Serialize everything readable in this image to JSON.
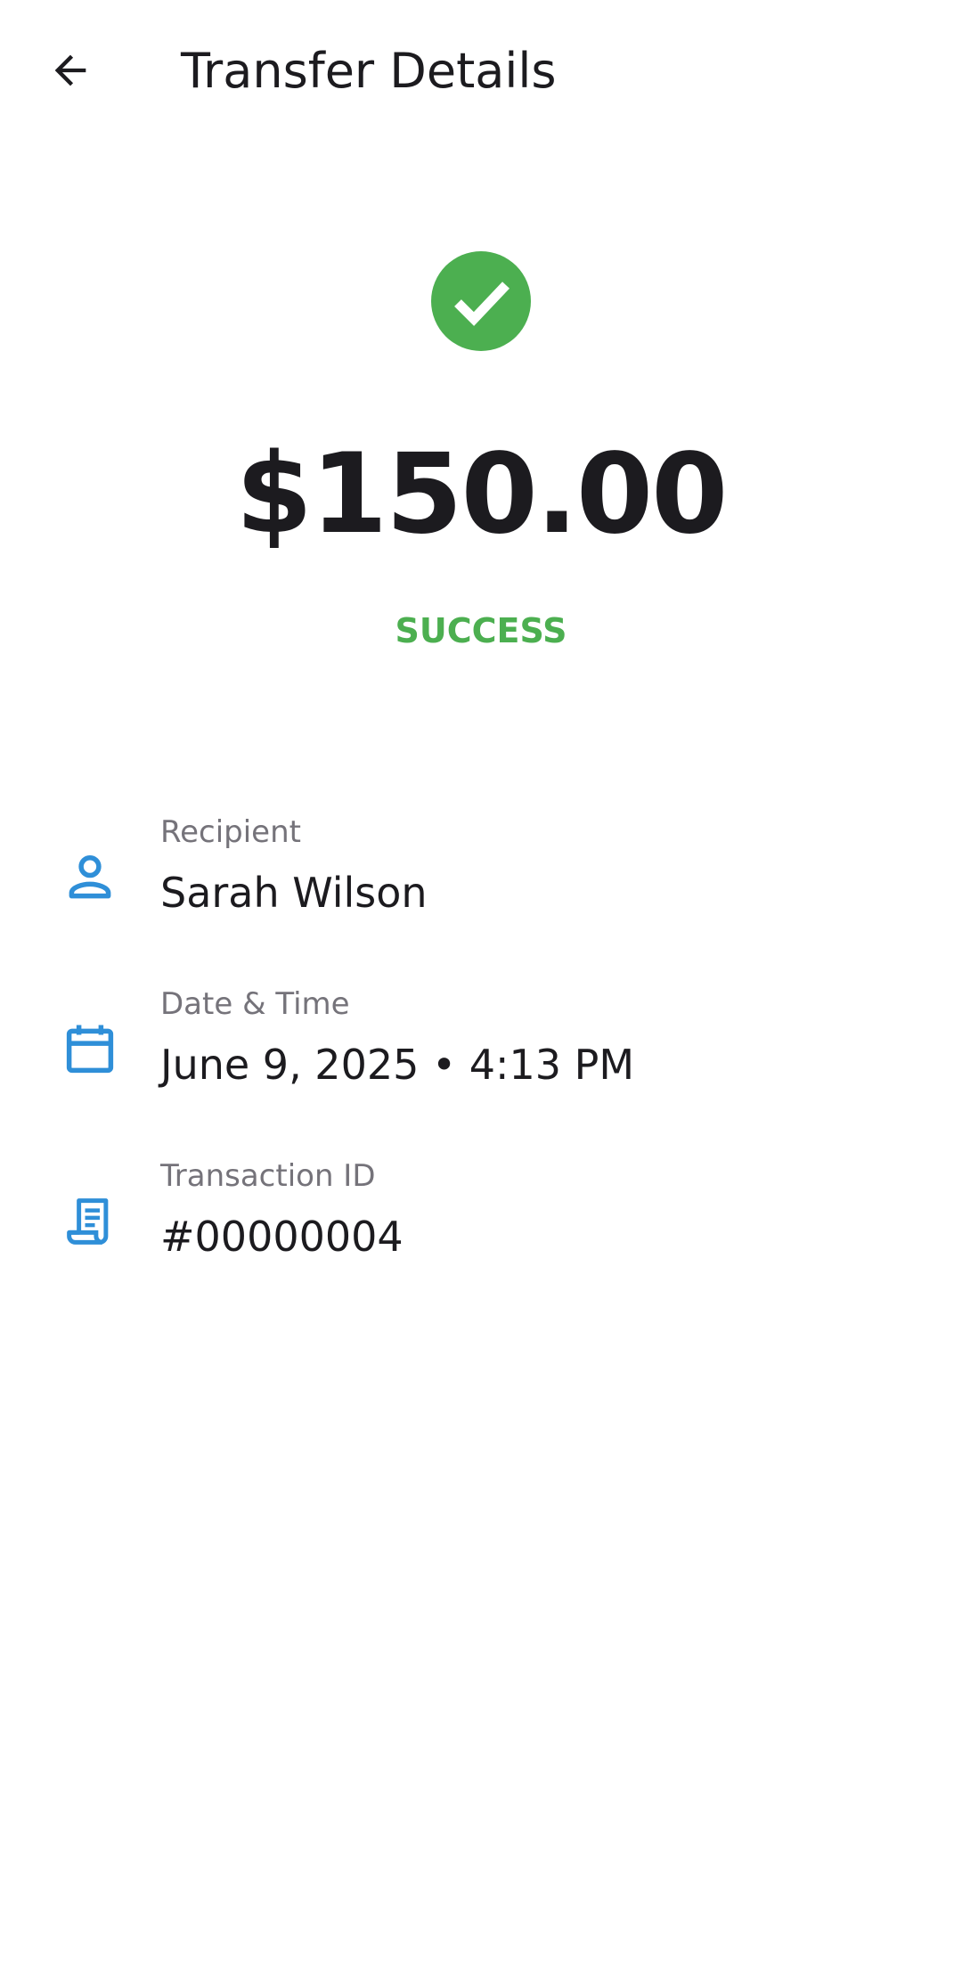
{
  "header": {
    "title": "Transfer Details",
    "back_icon": "arrow-back-icon"
  },
  "transfer": {
    "amount": "$150.00",
    "status": "SUCCESS",
    "status_icon": "check-circle-icon"
  },
  "details": [
    {
      "icon": "person-icon",
      "label": "Recipient",
      "value": "Sarah Wilson"
    },
    {
      "icon": "calendar-icon",
      "label": "Date & Time",
      "value": "June 9, 2025 • 4:13 PM"
    },
    {
      "icon": "receipt-icon",
      "label": "Transaction ID",
      "value": "#00000004"
    }
  ],
  "colors": {
    "success": "#4caf50",
    "accent": "#2f8fd8",
    "text_primary": "#1c1b1f",
    "text_secondary": "#75737a"
  }
}
